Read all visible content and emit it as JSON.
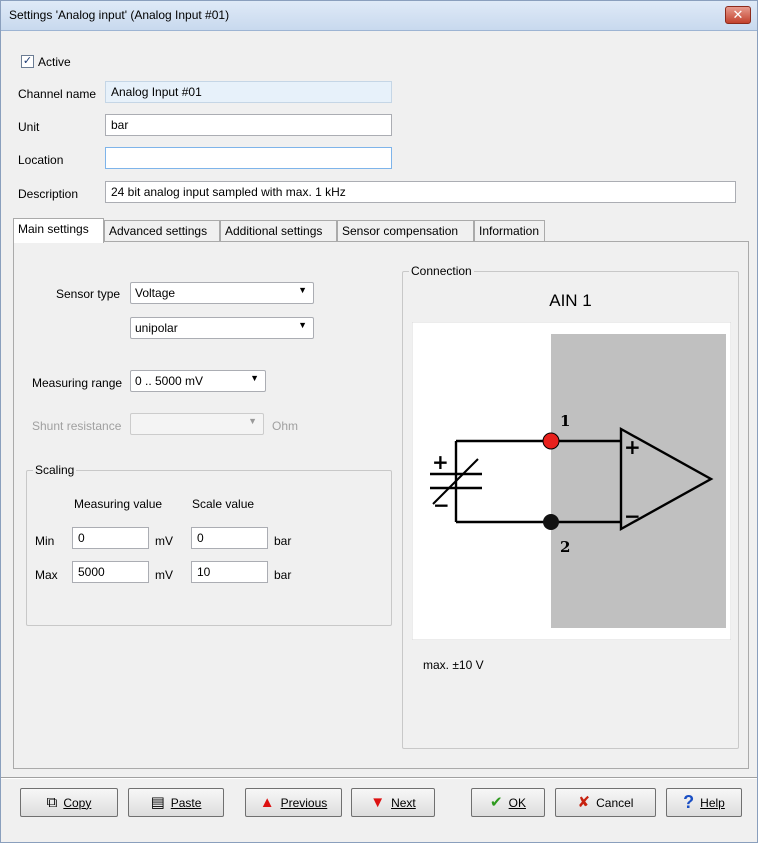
{
  "window": {
    "title": "Settings 'Analog input' (Analog Input #01)",
    "close_glyph": "✕"
  },
  "active": {
    "checked_glyph": "✓",
    "label": "Active"
  },
  "fields": {
    "channelname": {
      "label": "Channel name",
      "value": "Analog Input #01"
    },
    "unit": {
      "label": "Unit",
      "value": "bar"
    },
    "location": {
      "label": "Location",
      "value": ""
    },
    "description": {
      "label": "Description",
      "value": "24 bit analog input sampled with max. 1 kHz"
    }
  },
  "tabs": [
    "Main settings",
    "Advanced settings",
    "Additional settings",
    "Sensor compensation",
    "Information"
  ],
  "main": {
    "sensor_type_label": "Sensor type",
    "sensor_type_value": "Voltage",
    "sensor_mode_value": "unipolar",
    "measuring_range_label": "Measuring range",
    "measuring_range_value": "0 .. 5000 mV",
    "shunt_label": "Shunt resistance",
    "shunt_value": "",
    "shunt_unit": "Ohm",
    "combo_arrow": "▼"
  },
  "scaling": {
    "title": "Scaling",
    "measuring_header": "Measuring value",
    "scale_header": "Scale value",
    "rows": [
      {
        "label": "Min",
        "measuring": "0",
        "measuring_unit": "mV",
        "scale": "0",
        "scale_unit": "bar"
      },
      {
        "label": "Max",
        "measuring": "5000",
        "measuring_unit": "mV",
        "scale": "10",
        "scale_unit": "bar"
      }
    ]
  },
  "connection": {
    "title": "Connection",
    "channel": "AIN 1",
    "pin1": "1",
    "pin2": "2",
    "plus": "+",
    "minus": "−",
    "note": "max. ±10 V",
    "colors": {
      "pin1": "#e8201c",
      "pin2": "#111111",
      "panel": "#c0c0c0"
    }
  },
  "buttons": {
    "copy": {
      "label": "Copy",
      "icon": "copy-icon"
    },
    "paste": {
      "label": "Paste",
      "icon": "paste-icon"
    },
    "previous": {
      "label": "Previous",
      "icon": "arrow-up-icon"
    },
    "next": {
      "label": "Next",
      "icon": "arrow-down-icon"
    },
    "ok": {
      "label": "OK",
      "icon": "check-icon"
    },
    "cancel": {
      "label": "Cancel",
      "icon": "x-icon"
    },
    "help": {
      "label": "Help",
      "icon": "question-icon"
    }
  }
}
